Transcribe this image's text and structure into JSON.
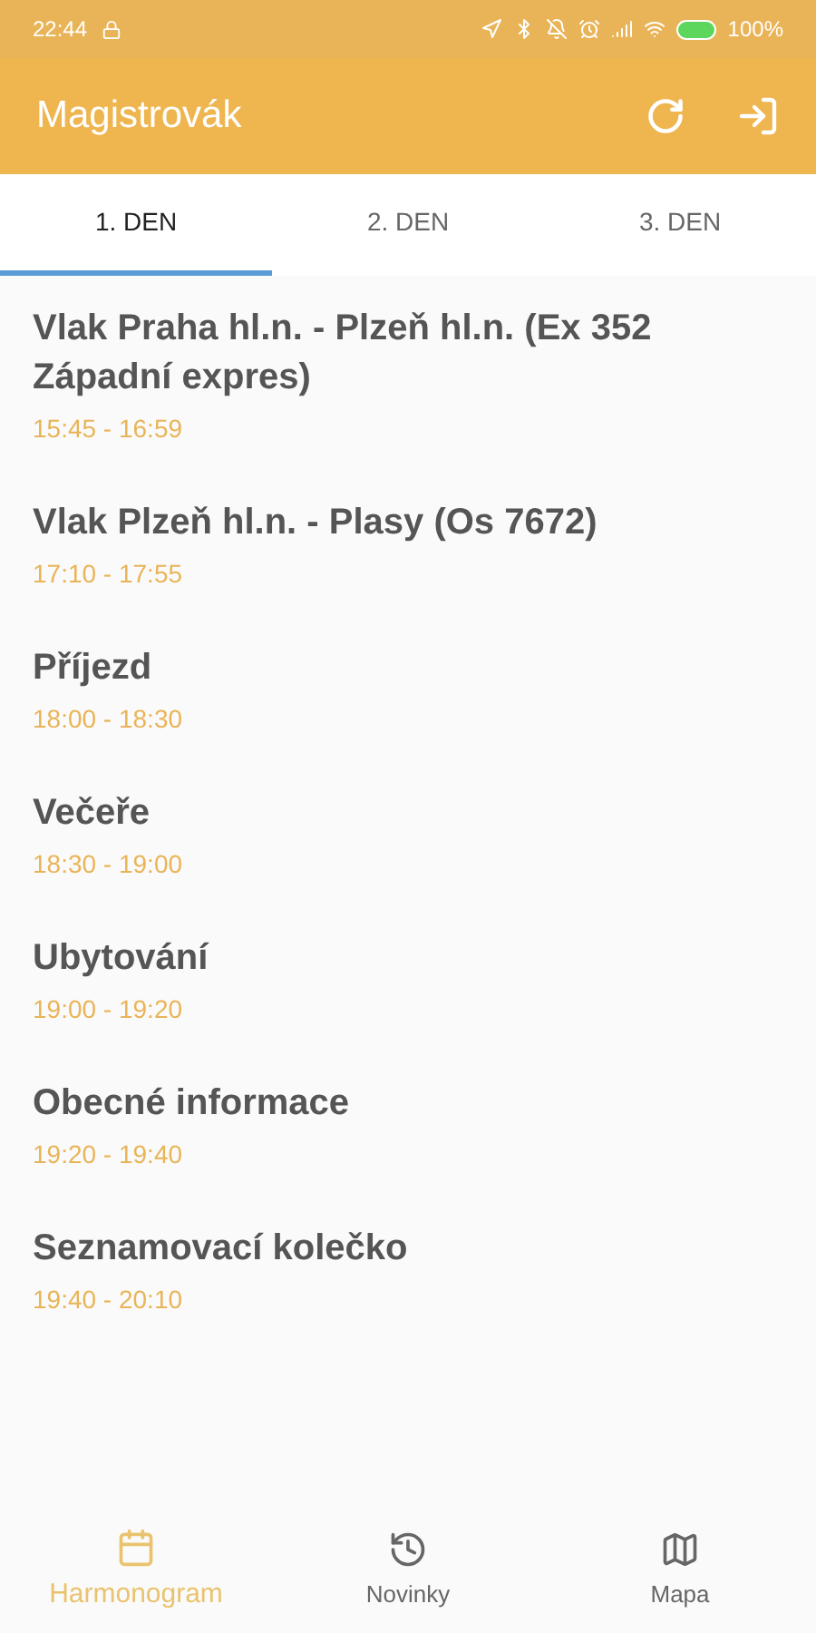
{
  "status_bar": {
    "time": "22:44",
    "battery": "100%"
  },
  "app_bar": {
    "title": "Magistrovák"
  },
  "tabs": [
    {
      "label": "1. DEN",
      "selected": true
    },
    {
      "label": "2. DEN",
      "selected": false
    },
    {
      "label": "3. DEN",
      "selected": false
    }
  ],
  "events": [
    {
      "title": "Vlak Praha hl.n. - Plzeň hl.n. (Ex 352 Západní expres)",
      "time": "15:45 - 16:59"
    },
    {
      "title": "Vlak Plzeň hl.n. - Plasy (Os 7672)",
      "time": "17:10 - 17:55"
    },
    {
      "title": "Příjezd",
      "time": "18:00 - 18:30"
    },
    {
      "title": "Večeře",
      "time": "18:30 - 19:00"
    },
    {
      "title": "Ubytování",
      "time": "19:00 - 19:20"
    },
    {
      "title": "Obecné informace",
      "time": "19:20 - 19:40"
    },
    {
      "title": "Seznamovací kolečko",
      "time": "19:40 - 20:10"
    }
  ],
  "bottom_nav": [
    {
      "label": "Harmonogram",
      "kind": "calendar",
      "selected": true
    },
    {
      "label": "Novinky",
      "kind": "history",
      "selected": false
    },
    {
      "label": "Mapa",
      "kind": "map",
      "selected": false
    }
  ]
}
